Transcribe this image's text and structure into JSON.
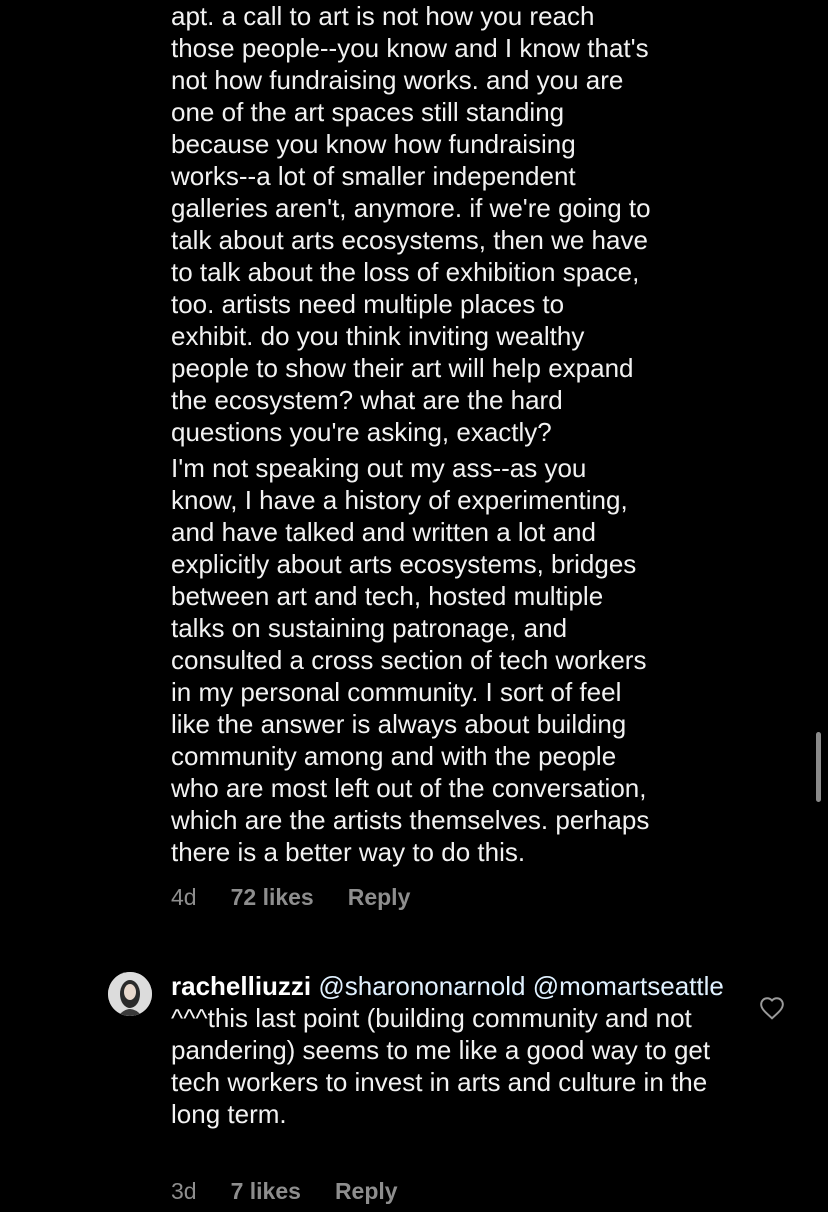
{
  "comment1": {
    "paragraph1": "apt. a call to art is not how you reach\nthose people--you know and I know that's\nnot how fundraising works. and you are\none of the art spaces still standing\nbecause you know how fundraising\nworks--a lot of smaller independent\ngalleries aren't, anymore. if we're going to\ntalk about arts ecosystems, then we have\nto talk about the loss of exhibition space,\ntoo. artists need multiple places to\nexhibit. do you think inviting wealthy\npeople to show their art will help expand\nthe ecosystem? what are the hard\nquestions you're asking, exactly?",
    "paragraph2": "I'm not speaking out my ass--as you\nknow, I have a history of experimenting,\nand have talked and written a lot and\nexplicitly about arts ecosystems, bridges\nbetween art and tech, hosted multiple\ntalks on sustaining patronage, and\nconsulted a cross section of tech workers\nin my personal community. I sort of feel\nlike the answer is always about building\ncommunity among and with the people\nwho are most left out of the conversation,\nwhich are the artists themselves. perhaps\nthere is a better way to do this.",
    "time": "4d",
    "likes": "72 likes",
    "reply": "Reply"
  },
  "comment2": {
    "username": "rachelliuzzi",
    "mention1": "@sharononarnold",
    "mention2": "@momartseattle",
    "text": " ^^^this last point (building community and not pandering) seems to me like a good way to get tech workers to invest in arts and culture in the long term.",
    "time": "3d",
    "likes": "7 likes",
    "reply": "Reply",
    "like_icon": "heart-outline-icon"
  }
}
